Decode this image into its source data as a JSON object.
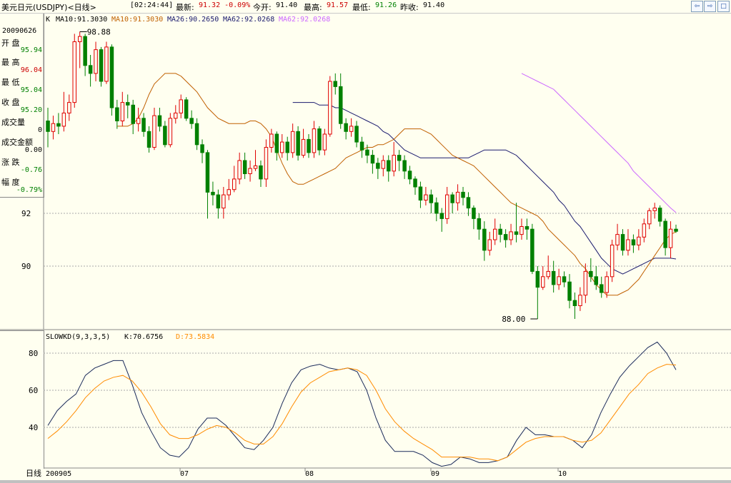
{
  "header": {
    "symbol": "美元日元(USDJPY)<日线>",
    "time": "[02:24:44]",
    "latest_label": "最新:",
    "latest_value": "91.32 -0.09%",
    "open_label": "今开:",
    "open_value": "91.40",
    "high_label": "最高:",
    "high_value": "91.57",
    "low_label": "最低:",
    "low_value": "91.26",
    "prev_close_label": "昨收:",
    "prev_close_value": "91.40"
  },
  "nav": {
    "left_icon": "arrow-left-icon",
    "right_icon": "arrow-right-icon"
  },
  "info_panel": {
    "date": "20090626",
    "open_label": "开  盘",
    "open_value": "95.94",
    "high_label": "最  高",
    "high_value": "96.04",
    "low_label": "最  低",
    "low_value": "95.04",
    "close_label": "收  盘",
    "close_value": "95.20",
    "volume_label": "成交量",
    "volume_value": "0",
    "amount_label": "成交金额",
    "amount_value": "0.00",
    "change_label": "涨  跌",
    "change_value": "-0.76",
    "pct_label": "幅  度",
    "pct_value": "-0.79%"
  },
  "main_legend": {
    "k": "K",
    "ma10_a": "MA10:91.3030",
    "ma10_b": "MA10:91.3030",
    "ma26": "MA26:90.2650",
    "ma62": "MA62:92.0268",
    "ma62_b": "MA62:92.0268"
  },
  "kd_legend": {
    "name": "SLOWKD(9,3,3,5)",
    "k": "K:70.6756",
    "d": "D:73.5834"
  },
  "period_label": "日线",
  "colors": {
    "up": "#e00000",
    "down": "#008000",
    "ma10": "#c06000",
    "ma26": "#1a1a6e",
    "ma62": "#cc66ff",
    "k_line": "#1a2a5a",
    "d_line": "#ff8c00",
    "background": "#fffff0"
  },
  "chart_data": [
    {
      "type": "candlestick",
      "title": "",
      "y_ticks": [
        "92",
        "90"
      ],
      "annotations": {
        "high_mark": "98.88",
        "low_mark": "88.00"
      },
      "x_ticks": [
        "200905",
        "07",
        "08",
        "09",
        "10"
      ],
      "candles": [
        [
          95.5,
          95.1,
          96.0,
          94.5
        ],
        [
          95.1,
          95.4,
          95.7,
          94.8
        ],
        [
          95.4,
          95.3,
          95.8,
          95.0
        ],
        [
          95.3,
          95.8,
          96.6,
          95.1
        ],
        [
          95.8,
          96.2,
          96.5,
          95.5
        ],
        [
          96.2,
          98.5,
          98.8,
          96.0
        ],
        [
          98.5,
          98.7,
          98.88,
          97.5
        ],
        [
          98.7,
          97.6,
          98.8,
          97.2
        ],
        [
          97.6,
          97.3,
          98.0,
          96.8
        ],
        [
          97.3,
          98.2,
          98.5,
          97.0
        ],
        [
          98.2,
          97.0,
          98.3,
          96.8
        ],
        [
          97.0,
          98.3,
          98.5,
          96.9
        ],
        [
          98.3,
          96.0,
          98.4,
          95.7
        ],
        [
          96.0,
          95.5,
          96.3,
          95.2
        ],
        [
          95.5,
          96.2,
          96.6,
          95.3
        ],
        [
          96.2,
          96.1,
          96.5,
          95.6
        ],
        [
          96.1,
          95.4,
          96.3,
          95.0
        ],
        [
          95.4,
          95.6,
          96.0,
          95.1
        ],
        [
          95.6,
          95.1,
          95.8,
          94.9
        ],
        [
          95.1,
          94.5,
          95.3,
          94.3
        ],
        [
          94.5,
          95.7,
          96.0,
          94.4
        ],
        [
          95.7,
          95.3,
          96.0,
          95.1
        ],
        [
          95.3,
          94.6,
          95.5,
          94.5
        ],
        [
          94.6,
          95.6,
          95.8,
          94.5
        ],
        [
          95.6,
          95.8,
          96.1,
          95.4
        ],
        [
          95.8,
          96.3,
          96.5,
          95.6
        ],
        [
          96.3,
          95.6,
          96.4,
          95.5
        ],
        [
          95.6,
          95.4,
          95.9,
          95.2
        ],
        [
          95.4,
          94.6,
          95.6,
          94.4
        ],
        [
          94.6,
          94.3,
          94.8,
          93.9
        ],
        [
          94.3,
          92.8,
          94.4,
          91.8
        ],
        [
          92.8,
          92.7,
          93.2,
          92.3
        ],
        [
          92.7,
          92.2,
          92.9,
          91.8
        ],
        [
          92.2,
          92.7,
          93.0,
          91.8
        ],
        [
          92.7,
          92.9,
          93.3,
          92.5
        ],
        [
          92.9,
          93.3,
          93.8,
          92.8
        ],
        [
          93.3,
          94.0,
          94.3,
          93.1
        ],
        [
          94.0,
          93.5,
          94.3,
          93.3
        ],
        [
          93.5,
          93.7,
          94.0,
          93.2
        ],
        [
          93.7,
          93.8,
          94.4,
          93.6
        ],
        [
          93.8,
          93.3,
          94.0,
          93.0
        ],
        [
          93.3,
          94.5,
          94.8,
          93.0
        ],
        [
          94.5,
          95.0,
          95.2,
          94.3
        ],
        [
          95.0,
          94.3,
          95.1,
          94.0
        ],
        [
          94.3,
          94.7,
          95.0,
          94.1
        ],
        [
          94.7,
          94.3,
          94.9,
          94.0
        ],
        [
          94.3,
          95.1,
          95.4,
          94.1
        ],
        [
          95.1,
          94.2,
          95.3,
          94.0
        ],
        [
          94.2,
          94.8,
          95.2,
          94.1
        ],
        [
          94.8,
          94.3,
          95.0,
          94.1
        ],
        [
          94.3,
          95.2,
          95.5,
          94.1
        ],
        [
          95.2,
          94.4,
          95.3,
          94.2
        ],
        [
          94.4,
          95.0,
          95.2,
          94.2
        ],
        [
          95.0,
          97.0,
          97.2,
          94.9
        ],
        [
          97.0,
          96.8,
          97.3,
          96.5
        ],
        [
          96.8,
          95.4,
          97.3,
          95.2
        ],
        [
          95.4,
          95.1,
          95.6,
          94.8
        ],
        [
          95.1,
          95.3,
          95.6,
          94.9
        ],
        [
          95.3,
          94.7,
          95.5,
          94.5
        ],
        [
          94.7,
          94.4,
          94.9,
          94.1
        ],
        [
          94.4,
          94.2,
          94.6,
          93.9
        ],
        [
          94.2,
          93.9,
          94.4,
          93.5
        ],
        [
          93.9,
          93.7,
          94.1,
          93.3
        ],
        [
          93.7,
          94.0,
          94.2,
          93.4
        ],
        [
          94.0,
          93.6,
          94.2,
          93.2
        ],
        [
          93.6,
          94.2,
          94.7,
          93.4
        ],
        [
          94.2,
          94.0,
          94.4,
          93.6
        ],
        [
          94.0,
          93.6,
          94.2,
          93.3
        ],
        [
          93.6,
          93.3,
          93.8,
          93.1
        ],
        [
          93.3,
          93.0,
          93.4,
          92.7
        ],
        [
          93.0,
          92.5,
          93.2,
          92.2
        ],
        [
          92.5,
          92.7,
          93.0,
          92.3
        ],
        [
          92.7,
          92.4,
          92.9,
          92.0
        ],
        [
          92.4,
          92.0,
          92.6,
          91.7
        ],
        [
          92.0,
          91.8,
          92.2,
          91.3
        ],
        [
          91.8,
          92.7,
          93.0,
          91.6
        ],
        [
          92.7,
          92.4,
          92.8,
          92.0
        ],
        [
          92.4,
          92.8,
          93.1,
          92.1
        ],
        [
          92.8,
          92.6,
          93.0,
          92.3
        ],
        [
          92.6,
          92.2,
          92.8,
          91.9
        ],
        [
          92.2,
          91.8,
          92.3,
          91.4
        ],
        [
          91.8,
          91.4,
          92.0,
          91.0
        ],
        [
          91.4,
          90.6,
          91.7,
          90.2
        ],
        [
          90.6,
          91.0,
          91.3,
          90.4
        ],
        [
          91.0,
          91.4,
          91.8,
          90.8
        ],
        [
          91.4,
          91.2,
          91.6,
          90.9
        ],
        [
          91.2,
          91.0,
          91.4,
          90.7
        ],
        [
          91.0,
          91.3,
          91.6,
          90.8
        ],
        [
          91.3,
          91.2,
          92.4,
          90.9
        ],
        [
          91.2,
          91.5,
          91.8,
          91.0
        ],
        [
          91.5,
          91.4,
          91.8,
          91.0
        ],
        [
          91.4,
          89.8,
          91.6,
          89.7
        ],
        [
          89.8,
          89.2,
          90.0,
          88.0
        ],
        [
          89.2,
          89.6,
          90.0,
          89.1
        ],
        [
          89.6,
          89.8,
          90.4,
          89.5
        ],
        [
          89.8,
          89.3,
          90.2,
          89.0
        ],
        [
          89.3,
          89.6,
          89.9,
          89.1
        ],
        [
          89.6,
          89.4,
          89.8,
          89.2
        ],
        [
          89.4,
          88.7,
          89.7,
          88.4
        ],
        [
          88.7,
          88.5,
          89.0,
          88.0
        ],
        [
          88.5,
          88.9,
          89.2,
          88.3
        ],
        [
          88.9,
          89.8,
          90.1,
          88.6
        ],
        [
          89.8,
          89.6,
          90.3,
          89.4
        ],
        [
          89.6,
          89.3,
          90.0,
          89.1
        ],
        [
          89.3,
          89.0,
          89.6,
          88.8
        ],
        [
          89.0,
          89.6,
          89.8,
          88.8
        ],
        [
          89.6,
          90.8,
          91.0,
          89.4
        ],
        [
          90.8,
          91.2,
          91.6,
          90.6
        ],
        [
          91.2,
          90.6,
          91.4,
          90.4
        ],
        [
          90.6,
          91.0,
          91.4,
          90.4
        ],
        [
          91.0,
          90.8,
          91.2,
          90.5
        ],
        [
          90.8,
          91.1,
          91.4,
          90.6
        ],
        [
          91.1,
          91.6,
          91.8,
          90.9
        ],
        [
          91.6,
          92.1,
          92.2,
          91.4
        ],
        [
          92.1,
          92.2,
          92.4,
          91.8
        ],
        [
          92.2,
          91.7,
          92.3,
          91.5
        ],
        [
          91.7,
          90.7,
          91.8,
          90.4
        ],
        [
          90.7,
          91.4,
          91.7,
          90.3
        ],
        [
          91.4,
          91.32,
          91.57,
          91.26
        ]
      ],
      "ma10": [
        95.3,
        95.3,
        95.3,
        95.4,
        95.6,
        96.0,
        96.5,
        96.9,
        97.1,
        97.3,
        97.3,
        97.3,
        97.2,
        97.0,
        96.8,
        96.6,
        96.3,
        96.0,
        95.8,
        95.6,
        95.5,
        95.4,
        95.4,
        95.4,
        95.4,
        95.5,
        95.5,
        95.4,
        95.2,
        94.9,
        94.4,
        93.9,
        93.5,
        93.2,
        93.1,
        93.1,
        93.2,
        93.3,
        93.4,
        93.5,
        93.6,
        93.7,
        93.9,
        94.1,
        94.2,
        94.3,
        94.4,
        94.5,
        94.5,
        94.6,
        94.6,
        94.7,
        94.8,
        95.0,
        95.2,
        95.2,
        95.2,
        95.2,
        95.1,
        95.0,
        94.8,
        94.6,
        94.4,
        94.2,
        94.1,
        94.0,
        93.9,
        93.8,
        93.6,
        93.4,
        93.2,
        93.0,
        92.8,
        92.6,
        92.4,
        92.3,
        92.2,
        92.1,
        92.0,
        91.9,
        91.7,
        91.4,
        91.2,
        91.0,
        90.8,
        90.6,
        90.4,
        90.1,
        89.9,
        89.6,
        89.3,
        89.1,
        88.9,
        88.9,
        88.9,
        89.0,
        89.1,
        89.3,
        89.5,
        89.8,
        90.1,
        90.4,
        90.7,
        91.0,
        91.2,
        91.3
      ],
      "ma26": [
        96.2,
        96.2,
        96.2,
        96.2,
        96.2,
        96.1,
        96.1,
        96.1,
        96.0,
        96.0,
        95.9,
        95.8,
        95.7,
        95.6,
        95.5,
        95.4,
        95.3,
        95.1,
        95.0,
        94.8,
        94.6,
        94.4,
        94.3,
        94.2,
        94.1,
        94.1,
        94.1,
        94.1,
        94.1,
        94.1,
        94.1,
        94.1,
        94.1,
        94.1,
        94.2,
        94.3,
        94.4,
        94.4,
        94.4,
        94.4,
        94.4,
        94.3,
        94.2,
        94.0,
        93.8,
        93.6,
        93.4,
        93.2,
        93.0,
        92.8,
        92.5,
        92.3,
        92.0,
        91.7,
        91.5,
        91.2,
        90.9,
        90.6,
        90.3,
        90.1,
        89.9,
        89.8,
        89.7,
        89.8,
        89.9,
        90.0,
        90.1,
        90.2,
        90.3,
        90.3,
        90.3,
        90.3,
        90.27
      ],
      "ma62": [
        97.3,
        97.2,
        97.1,
        97.0,
        96.9,
        96.8,
        96.7,
        96.5,
        96.3,
        96.1,
        95.9,
        95.7,
        95.5,
        95.3,
        95.1,
        94.9,
        94.7,
        94.5,
        94.3,
        94.1,
        93.9,
        93.6,
        93.4,
        93.2,
        93.0,
        92.8,
        92.6,
        92.4,
        92.2,
        92.03
      ]
    },
    {
      "type": "line",
      "title": "",
      "y_ticks": [
        "80",
        "60",
        "40"
      ],
      "ylim": [
        20,
        90
      ],
      "series": [
        {
          "name": "K",
          "values": [
            41,
            49,
            54,
            58,
            68,
            72,
            74,
            76,
            76,
            63,
            48,
            38,
            29,
            25,
            24,
            29,
            39,
            45,
            45,
            41,
            35,
            29,
            28,
            33,
            40,
            53,
            64,
            71,
            73,
            74,
            72,
            71,
            72,
            70,
            60,
            45,
            33,
            27,
            27,
            27,
            25,
            21,
            19,
            20,
            24,
            23,
            21,
            21,
            22,
            24,
            33,
            40,
            36,
            36,
            35,
            35,
            33,
            29,
            36,
            48,
            58,
            67,
            73,
            78,
            83,
            86,
            80,
            71
          ]
        },
        {
          "name": "D",
          "values": [
            34,
            38,
            43,
            49,
            56,
            61,
            65,
            67,
            68,
            65,
            59,
            51,
            42,
            36,
            34,
            34,
            36,
            39,
            41,
            40,
            37,
            33,
            31,
            31,
            35,
            42,
            51,
            59,
            64,
            67,
            70,
            71,
            72,
            71,
            68,
            60,
            50,
            43,
            38,
            34,
            31,
            28,
            24,
            24,
            24,
            24,
            23,
            23,
            22,
            24,
            28,
            32,
            34,
            35,
            35,
            35,
            33,
            32,
            33,
            37,
            44,
            51,
            58,
            63,
            69,
            72,
            74,
            73.6
          ]
        }
      ]
    }
  ]
}
